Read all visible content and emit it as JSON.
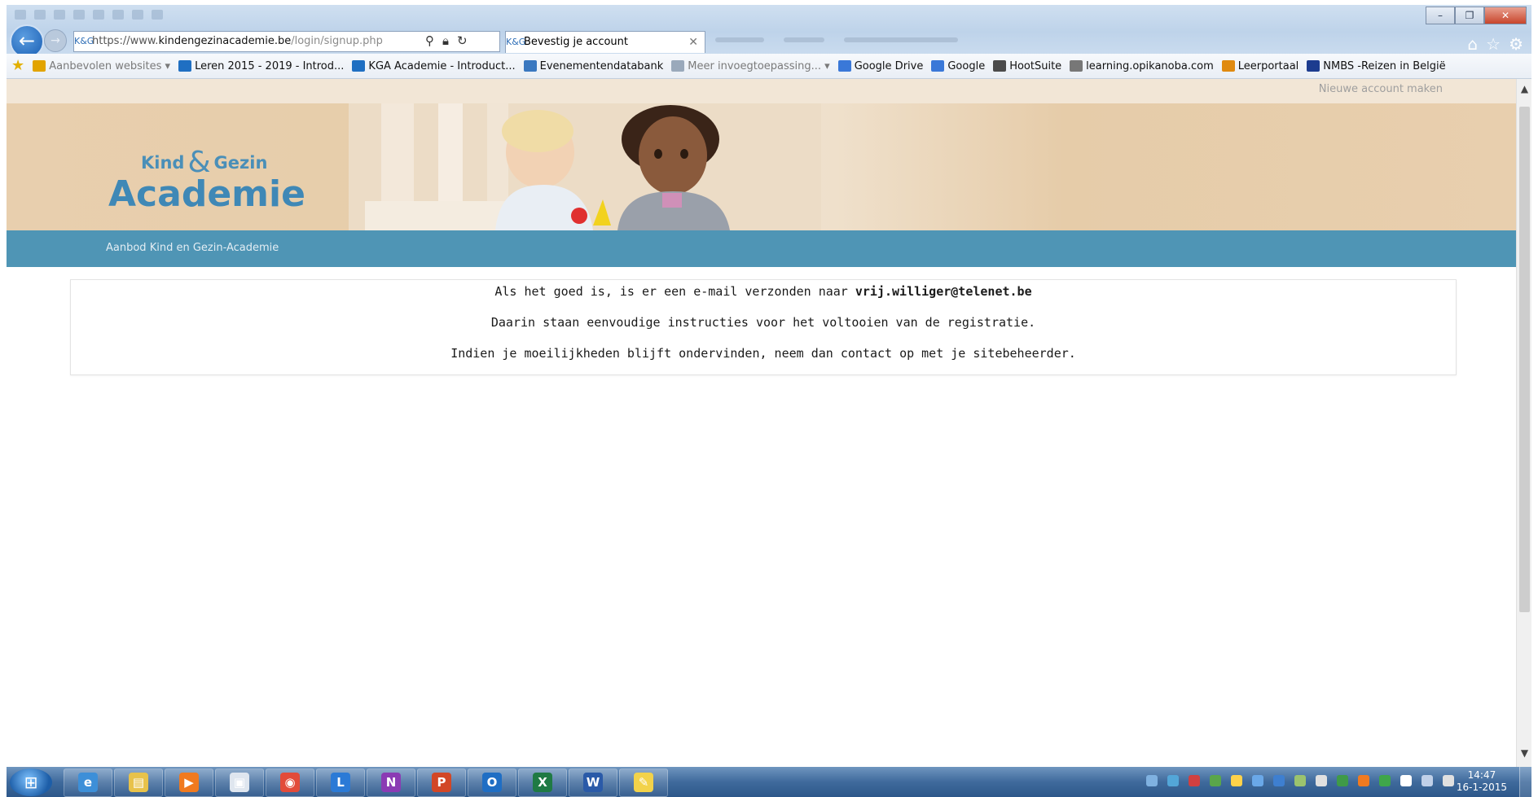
{
  "browser": {
    "url_prefix": "https://www.",
    "url_domain": "kindengezinacademie.be",
    "url_path": "/login/signup.php",
    "tab_title": "Bevestig je account",
    "favicon_text": "K&G",
    "favorites": [
      {
        "label": "Aanbevolen websites ▾",
        "color": "#e2a400",
        "dim": true
      },
      {
        "label": "Leren 2015 - 2019 - Introd...",
        "color": "#1f6fc2",
        "dim": false
      },
      {
        "label": "KGA Academie - Introduct...",
        "color": "#1f6fc2",
        "dim": false
      },
      {
        "label": "Evenementendatabank",
        "color": "#3a78c0",
        "dim": false
      },
      {
        "label": "Meer invoegtoepassing... ▾",
        "color": "#9aa9bb",
        "dim": true
      },
      {
        "label": "Google Drive",
        "color": "#3a78d8",
        "dim": false
      },
      {
        "label": "Google",
        "color": "#3a78d8",
        "dim": false
      },
      {
        "label": "HootSuite",
        "color": "#4b4b4b",
        "dim": false
      },
      {
        "label": "learning.opikanoba.com",
        "color": "#777777",
        "dim": false
      },
      {
        "label": "Leerportaal",
        "color": "#e08a10",
        "dim": false
      },
      {
        "label": "NMBS -Reizen in België",
        "color": "#1d3c8f",
        "dim": false
      }
    ]
  },
  "page": {
    "new_account_link": "Nieuwe account maken",
    "logo_small_left": "Kind",
    "logo_amp": "&",
    "logo_small_right": "Gezin",
    "logo_big": "Academie",
    "nav_link": "Aanbod Kind en Gezin-Academie",
    "msg1_prefix": "Als het goed is, is er een e-mail verzonden naar ",
    "msg1_email": "vrij.williger@telenet.be",
    "msg2": "Daarin staan eenvoudige instructies voor het voltooien van de registratie.",
    "msg3": "Indien je moeilijkheden blijft ondervinden, neem dan contact op met je sitebeheerder."
  },
  "taskbar": {
    "apps": [
      {
        "name": "ie",
        "label": "e",
        "color": "#3d8fd8"
      },
      {
        "name": "explorer",
        "label": "▤",
        "color": "#e8c24a"
      },
      {
        "name": "media-player",
        "label": "▶",
        "color": "#f07a1f"
      },
      {
        "name": "window-app",
        "label": "▣",
        "color": "#dfe6ef"
      },
      {
        "name": "chrome",
        "label": "◉",
        "color": "#e24b3a"
      },
      {
        "name": "lync",
        "label": "L",
        "color": "#2b7ad6"
      },
      {
        "name": "onenote",
        "label": "N",
        "color": "#8b3bb4"
      },
      {
        "name": "powerpoint",
        "label": "P",
        "color": "#d24726"
      },
      {
        "name": "outlook",
        "label": "O",
        "color": "#1f6ec4"
      },
      {
        "name": "excel",
        "label": "X",
        "color": "#1f7a44"
      },
      {
        "name": "word",
        "label": "W",
        "color": "#2a5aa8"
      },
      {
        "name": "sticky-notes",
        "label": "✎",
        "color": "#f2d24a"
      }
    ],
    "tray_colors": [
      "#7fb1e0",
      "#53a6d8",
      "#d04040",
      "#5aa64a",
      "#ffd24a",
      "#6aa8e8",
      "#3e7fd0",
      "#9bc36e",
      "#e0e0e0",
      "#3f9a48",
      "#f07a1f",
      "#3fa64a",
      "#ffffff",
      "#c0d0e8",
      "#e0e0e0"
    ],
    "clock_time": "14:47",
    "clock_date": "16-1-2015"
  }
}
